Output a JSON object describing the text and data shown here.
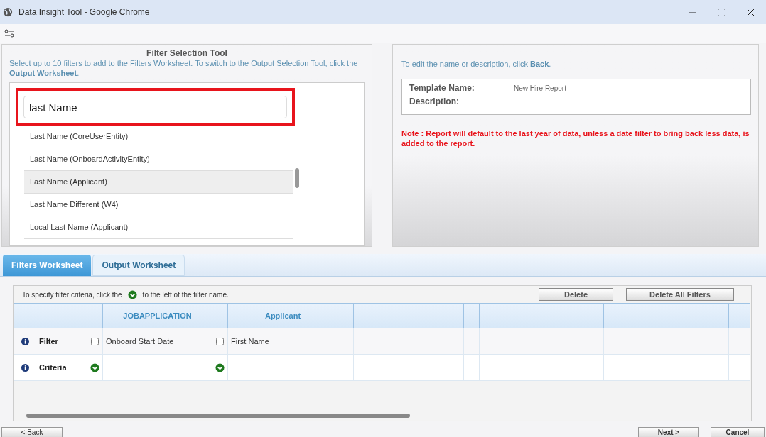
{
  "window": {
    "title": "Data Insight Tool - Google Chrome"
  },
  "filter_tool": {
    "title": "Filter Selection Tool",
    "instructions": "Select up to 10 filters to add to the Filters Worksheet. To switch to the Output Selection Tool, click the **Output Worksheet**.",
    "search": {
      "value": "last Name",
      "highlighted": true
    },
    "results": [
      {
        "label": "Last Name (CoreUserEntity)",
        "selected": false
      },
      {
        "label": "Last Name (OnboardActivityEntity)",
        "selected": false
      },
      {
        "label": "Last Name (Applicant)",
        "selected": true
      },
      {
        "label": "Last Name Different (W4)",
        "selected": false
      },
      {
        "label": "Local Last Name (Applicant)",
        "selected": false
      }
    ]
  },
  "template": {
    "instructions": "To edit the name or description, click **Back**.",
    "fields": [
      {
        "label": "Template Name:",
        "value": "New Hire Report"
      },
      {
        "label": "Description:"
      }
    ],
    "note": "Note : Report will default to the last year of data, unless a date filter to bring back less data, is added to the report."
  },
  "tabs": [
    {
      "label": "Filters Worksheet",
      "selected": true
    },
    {
      "label": "Output Worksheet",
      "selected": false
    }
  ],
  "worksheet": {
    "hint_before": "To specify filter criteria, click the",
    "hint_after": "to the left of the filter name.",
    "buttons": [
      "Delete",
      "Delete All Filters"
    ],
    "row_labels": [
      "Filter",
      "Criteria"
    ],
    "columns": [
      {
        "header": "JOBAPPLICATION",
        "filter": "Onboard Start Date",
        "checked": false
      },
      {
        "header": "Applicant",
        "filter": "First Name",
        "checked": false
      }
    ]
  },
  "nav_buttons": [
    "< Back",
    "Next >",
    "Cancel"
  ]
}
